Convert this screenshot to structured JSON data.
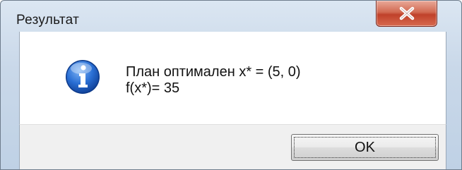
{
  "window": {
    "title": "Результат"
  },
  "message": {
    "line1": "План оптимален x* = (5, 0)",
    "line2": "f(x*)= 35"
  },
  "buttons": {
    "ok_label": "OK"
  },
  "icons": {
    "title_close": "close-icon",
    "message_type": "info-icon"
  },
  "colors": {
    "close_button": "#c0412a",
    "info_icon": "#1f63c6"
  }
}
